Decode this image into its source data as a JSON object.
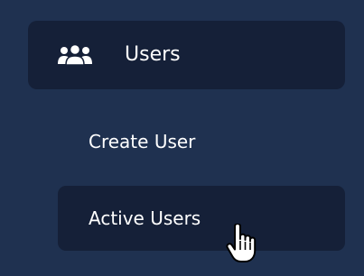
{
  "nav": {
    "parent": {
      "label": "Users",
      "icon": "users-group-icon"
    },
    "children": [
      {
        "label": "Create User",
        "active": false
      },
      {
        "label": "Active Users",
        "active": true
      }
    ]
  },
  "cursor": {
    "icon": "hand-pointer-icon"
  },
  "colors": {
    "background": "#1f3150",
    "item_background": "#152038",
    "text": "#ffffff"
  }
}
